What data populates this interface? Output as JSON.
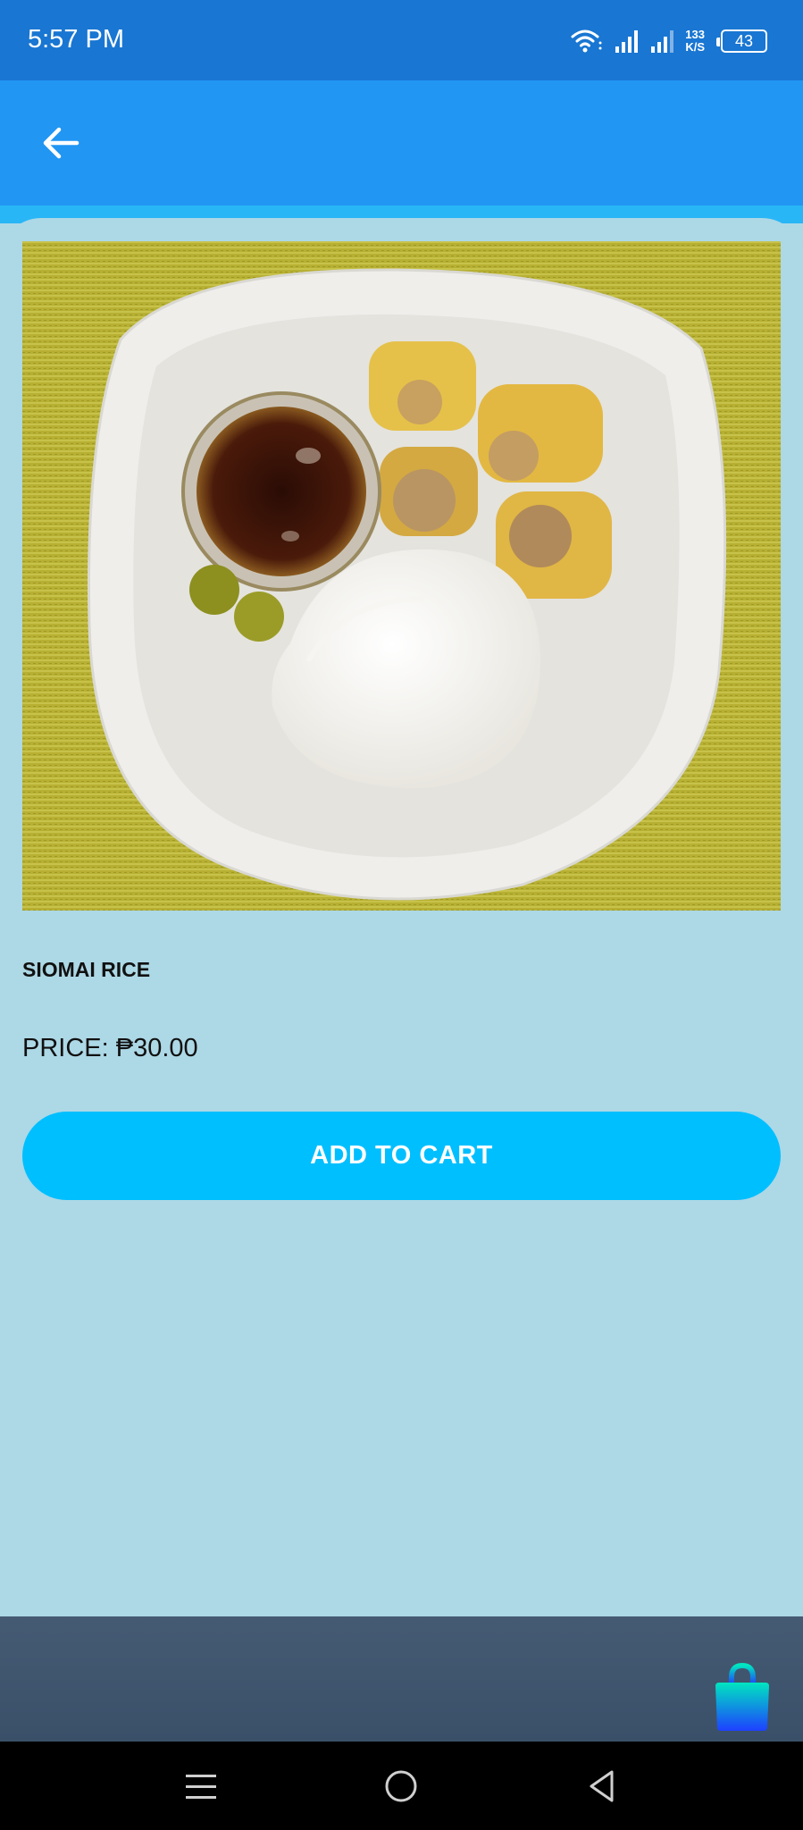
{
  "status_bar": {
    "time": "5:57 PM",
    "net_speed_value": "133",
    "net_speed_unit": "K/S",
    "battery_level": "43",
    "icons": [
      "wifi-icon",
      "signal-icon",
      "signal-icon",
      "battery-icon"
    ]
  },
  "app_bar": {
    "back_icon": "arrow-back-icon"
  },
  "product": {
    "name": "SIOMAI RICE",
    "price_label": "PRICE: ₱30.00",
    "image_icon": "siomai-rice-photo"
  },
  "actions": {
    "add_to_cart_label": "ADD TO CART",
    "cart_icon": "shopping-bag-icon"
  },
  "nav": {
    "icons": [
      "menu-icon",
      "home-icon",
      "back-triangle-icon"
    ]
  },
  "colors": {
    "status_bar": "#1976d2",
    "app_bar": "#2196f3",
    "background": "#add8e6",
    "button": "#00bfff",
    "bottom_bar": "#455a73"
  }
}
